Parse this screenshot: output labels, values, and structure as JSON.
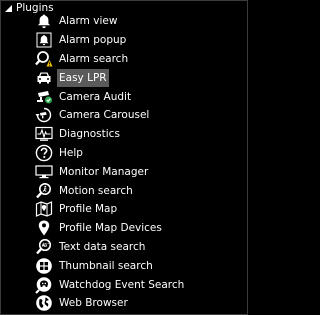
{
  "tree": {
    "header": {
      "label": "Plugins",
      "caret_icon": "collapse-triangle-icon"
    },
    "items": [
      {
        "label": "Alarm view",
        "icon": "alarm-bell-icon"
      },
      {
        "label": "Alarm popup",
        "icon": "alarm-bell-popup-icon"
      },
      {
        "label": "Alarm search",
        "icon": "alarm-search-icon"
      },
      {
        "label": "Easy LPR",
        "icon": "car-icon",
        "selected": true
      },
      {
        "label": "Camera Audit",
        "icon": "camera-audit-icon"
      },
      {
        "label": "Camera Carousel",
        "icon": "camera-carousel-icon"
      },
      {
        "label": "Diagnostics",
        "icon": "diagnostics-icon"
      },
      {
        "label": "Help",
        "icon": "help-icon"
      },
      {
        "label": "Monitor Manager",
        "icon": "monitor-icon"
      },
      {
        "label": "Motion search",
        "icon": "motion-search-icon"
      },
      {
        "label": "Profile Map",
        "icon": "map-icon"
      },
      {
        "label": "Profile Map Devices",
        "icon": "map-devices-icon"
      },
      {
        "label": "Text data search",
        "icon": "text-search-icon"
      },
      {
        "label": "Thumbnail search",
        "icon": "thumbnail-search-icon"
      },
      {
        "label": "Watchdog Event Search",
        "icon": "watchdog-search-icon"
      },
      {
        "label": "Web Browser",
        "icon": "globe-icon"
      }
    ]
  },
  "colors": {
    "background": "#000000",
    "text": "#ffffff",
    "selection": "#5a5a5a",
    "accent_yellow": "#f5c400",
    "accent_green": "#2fa84f"
  }
}
